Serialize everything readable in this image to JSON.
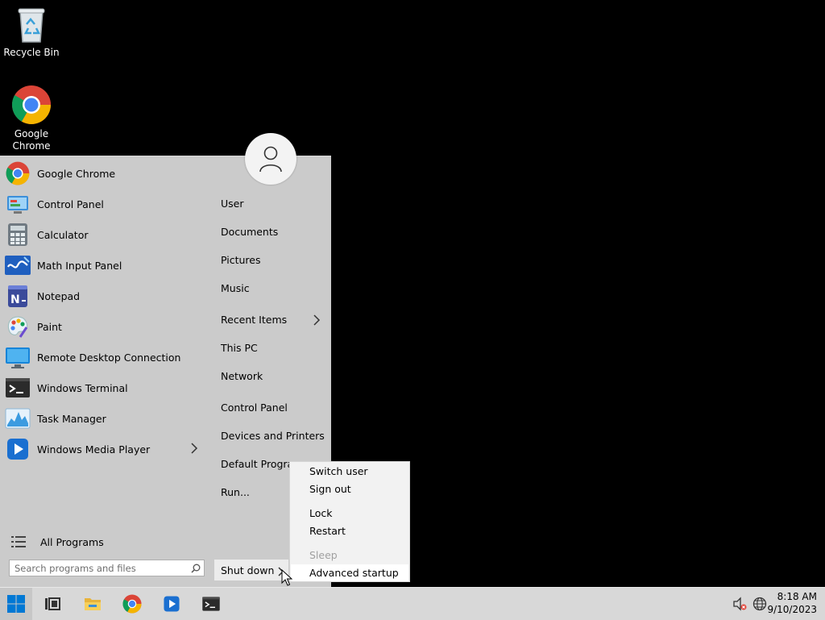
{
  "desktop": {
    "icons": [
      {
        "label": "Recycle Bin",
        "icon": "recycle-bin-icon"
      },
      {
        "label": "Google\nChrome",
        "icon": "chrome-icon"
      }
    ]
  },
  "start_menu": {
    "apps": [
      {
        "label": "Google Chrome",
        "icon": "chrome-icon"
      },
      {
        "label": "Control Panel",
        "icon": "control-panel-icon"
      },
      {
        "label": "Calculator",
        "icon": "calculator-icon"
      },
      {
        "label": "Math Input Panel",
        "icon": "math-input-icon"
      },
      {
        "label": "Notepad",
        "icon": "notepad-icon"
      },
      {
        "label": "Paint",
        "icon": "paint-icon"
      },
      {
        "label": "Remote Desktop Connection",
        "icon": "remote-desktop-icon"
      },
      {
        "label": "Windows Terminal",
        "icon": "terminal-icon"
      },
      {
        "label": "Task Manager",
        "icon": "task-manager-icon"
      },
      {
        "label": "Windows Media Player",
        "icon": "media-player-icon",
        "has_submenu": true
      }
    ],
    "places": [
      {
        "label": "User"
      },
      {
        "label": "Documents"
      },
      {
        "label": "Pictures"
      },
      {
        "label": "Music"
      },
      {
        "label": "Recent Items",
        "has_submenu": true
      },
      {
        "label": "This PC"
      },
      {
        "label": "Network"
      },
      {
        "label": "Control Panel"
      },
      {
        "label": "Devices and Printers"
      },
      {
        "label": "Default Programs"
      },
      {
        "label": "Run..."
      }
    ],
    "all_programs": "All Programs",
    "search_placeholder": "Search programs and files",
    "shutdown_label": "Shut down"
  },
  "power_menu": {
    "items": [
      {
        "label": "Switch user",
        "enabled": true
      },
      {
        "label": "Sign out",
        "enabled": true
      },
      {
        "label": "Lock",
        "enabled": true
      },
      {
        "label": "Restart",
        "enabled": true
      },
      {
        "label": "Sleep",
        "enabled": false
      },
      {
        "label": "Advanced startup",
        "enabled": true,
        "highlighted": true
      }
    ]
  },
  "taskbar": {
    "pinned": [
      "start-icon",
      "task-view-icon",
      "file-explorer-icon",
      "chrome-icon",
      "media-player-icon",
      "terminal-icon"
    ],
    "clock": {
      "time": "8:18 AM",
      "date": "9/10/2023"
    }
  },
  "colors": {
    "accent": "#0078d4",
    "menu_bg": "#cbcbcb",
    "flyout_bg": "#f2f2f2",
    "taskbar_bg": "#d8d8d8"
  }
}
